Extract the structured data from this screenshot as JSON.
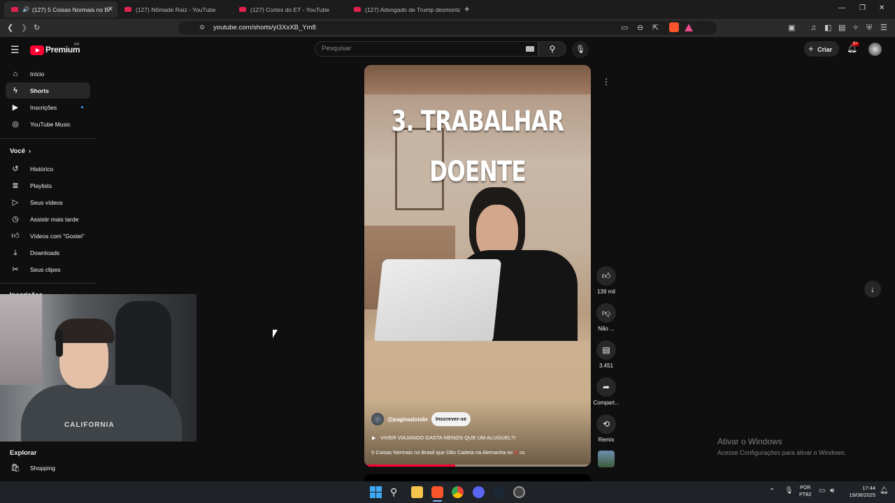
{
  "browser": {
    "tabs": [
      {
        "label": "(127) 5 Coisas Normais no Br",
        "active": true
      },
      {
        "label": "(127) Nômade Raiz - YouTube",
        "active": false
      },
      {
        "label": "(127) Cortes do ET - YouTube",
        "active": false
      },
      {
        "label": "(127) Advogado de Trump desmonta",
        "active": false
      }
    ],
    "url": "youtube.com/shorts/yI3XxXB_Ym8",
    "new_tab_icon": "plus-icon"
  },
  "youtube": {
    "logo_text": "Premium",
    "region": "BR",
    "search_placeholder": "Pesquisar",
    "create_label": "Criar",
    "notifications_badge": "9+",
    "sidebar": {
      "main": [
        {
          "label": "Início",
          "icon": "home-icon"
        },
        {
          "label": "Shorts",
          "icon": "shorts-icon"
        },
        {
          "label": "Inscrições",
          "icon": "subscriptions-icon"
        },
        {
          "label": "YouTube Music",
          "icon": "music-icon"
        }
      ],
      "you_header": "Você",
      "you": [
        {
          "label": "Histórico",
          "icon": "history-icon"
        },
        {
          "label": "Playlists",
          "icon": "playlists-icon"
        },
        {
          "label": "Seus vídeos",
          "icon": "your-videos-icon"
        },
        {
          "label": "Assistir mais tarde",
          "icon": "watch-later-icon"
        },
        {
          "label": "Vídeos com \"Gostei\"",
          "icon": "liked-icon"
        },
        {
          "label": "Downloads",
          "icon": "download-icon"
        },
        {
          "label": "Seus clipes",
          "icon": "clips-icon"
        }
      ],
      "subscriptions_header": "Inscrições",
      "explore_header": "Explorar",
      "explore": [
        {
          "label": "Shopping",
          "icon": "shopping-icon"
        }
      ]
    },
    "short": {
      "overlay_line1": "3. TRABALHAR",
      "overlay_line2": "DOENTE",
      "channel": "@paginadoisbr",
      "subscribe_label": "Inscrever-se",
      "playlist_link": "VIVER VIAJANDO GASTA MENOS QUE UM ALUGUEL?!",
      "title": "5 Coisas Normais no Brasil que Dão Cadeia na Alemanha",
      "title_suffix": "BR 🚫 DE",
      "progress_fraction": 0.4,
      "actions": {
        "likes": "139 mil",
        "dislike": "Não ...",
        "comments": "3.451",
        "share": "Compart...",
        "remix": "Remix"
      }
    }
  },
  "windows": {
    "watermark_title": "Ativar o Windows",
    "watermark_sub": "Acesse Configurações para ativar o Windows.",
    "lang1": "POR",
    "lang2": "PTB2",
    "time": "17:44",
    "date": "19/08/2025"
  }
}
